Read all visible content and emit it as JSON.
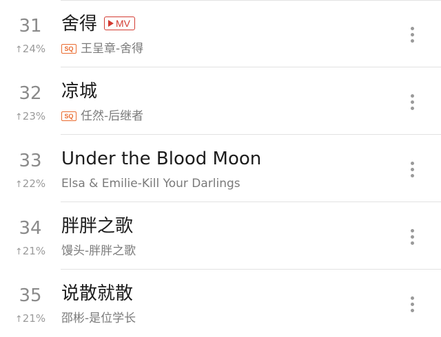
{
  "songs": [
    {
      "rank": "31",
      "trend": "24%",
      "title": "舍得",
      "mv_label": "MV",
      "sq": true,
      "sq_label": "SQ",
      "artist": "王呈章",
      "album": "舍得"
    },
    {
      "rank": "32",
      "trend": "23%",
      "title": "凉城",
      "sq": true,
      "sq_label": "SQ",
      "artist": "任然",
      "album": "后继者"
    },
    {
      "rank": "33",
      "trend": "22%",
      "title": "Under the Blood Moon",
      "sq": false,
      "artist": "Elsa & Emilie",
      "album": "Kill Your Darlings"
    },
    {
      "rank": "34",
      "trend": "21%",
      "title": "胖胖之歌",
      "sq": false,
      "artist": "馒头",
      "album": "胖胖之歌"
    },
    {
      "rank": "35",
      "trend": "21%",
      "title": "说散就散",
      "sq": false,
      "artist": "邵彬",
      "album": "是位学长"
    }
  ],
  "separator": " - ",
  "trend_arrow": "↑",
  "icons": {
    "trend": "arrow-up-icon",
    "more": "more-vertical-icon",
    "mv": "play-icon"
  },
  "colors": {
    "mv_badge": "#d33a31",
    "sq_badge": "#ea6b2f",
    "rank": "#8a8a8a",
    "subtitle": "#7a7a7a"
  }
}
